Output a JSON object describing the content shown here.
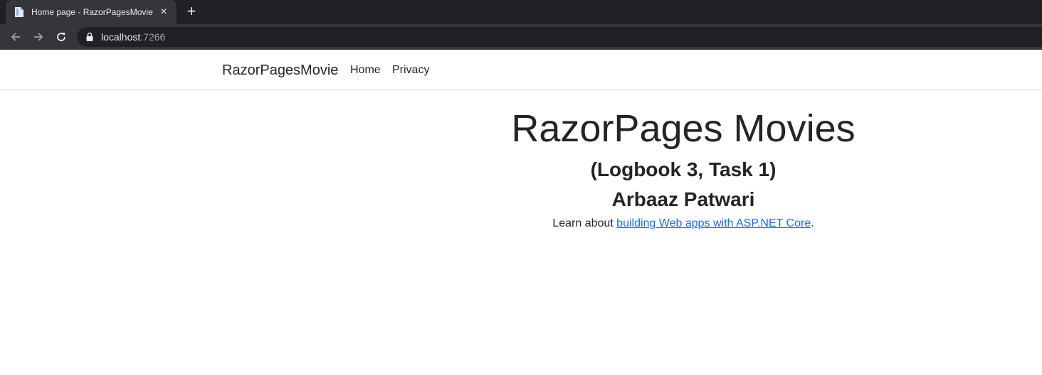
{
  "browser": {
    "tab_title": "Home page - RazorPagesMovie",
    "close_symbol": "×",
    "new_tab_symbol": "+",
    "url_host": "localhost",
    "url_port": ":7266"
  },
  "navbar": {
    "brand": "RazorPagesMovie",
    "links": [
      "Home",
      "Privacy"
    ]
  },
  "main": {
    "title": "RazorPages Movies",
    "subtitle": "(Logbook 3, Task 1)",
    "author": "Arbaaz Patwari",
    "learn_prefix": "Learn about ",
    "learn_link": "building Web apps with ASP.NET Core",
    "learn_suffix": "."
  },
  "colors": {
    "tabstrip_bg": "#202124",
    "toolbar_bg": "#35363a",
    "link": "#0d6efd",
    "text": "#212529"
  },
  "icons": {
    "favicon": "document-icon",
    "back": "arrow-left-icon",
    "forward": "arrow-right-icon",
    "reload": "reload-icon",
    "lock": "lock-icon"
  }
}
